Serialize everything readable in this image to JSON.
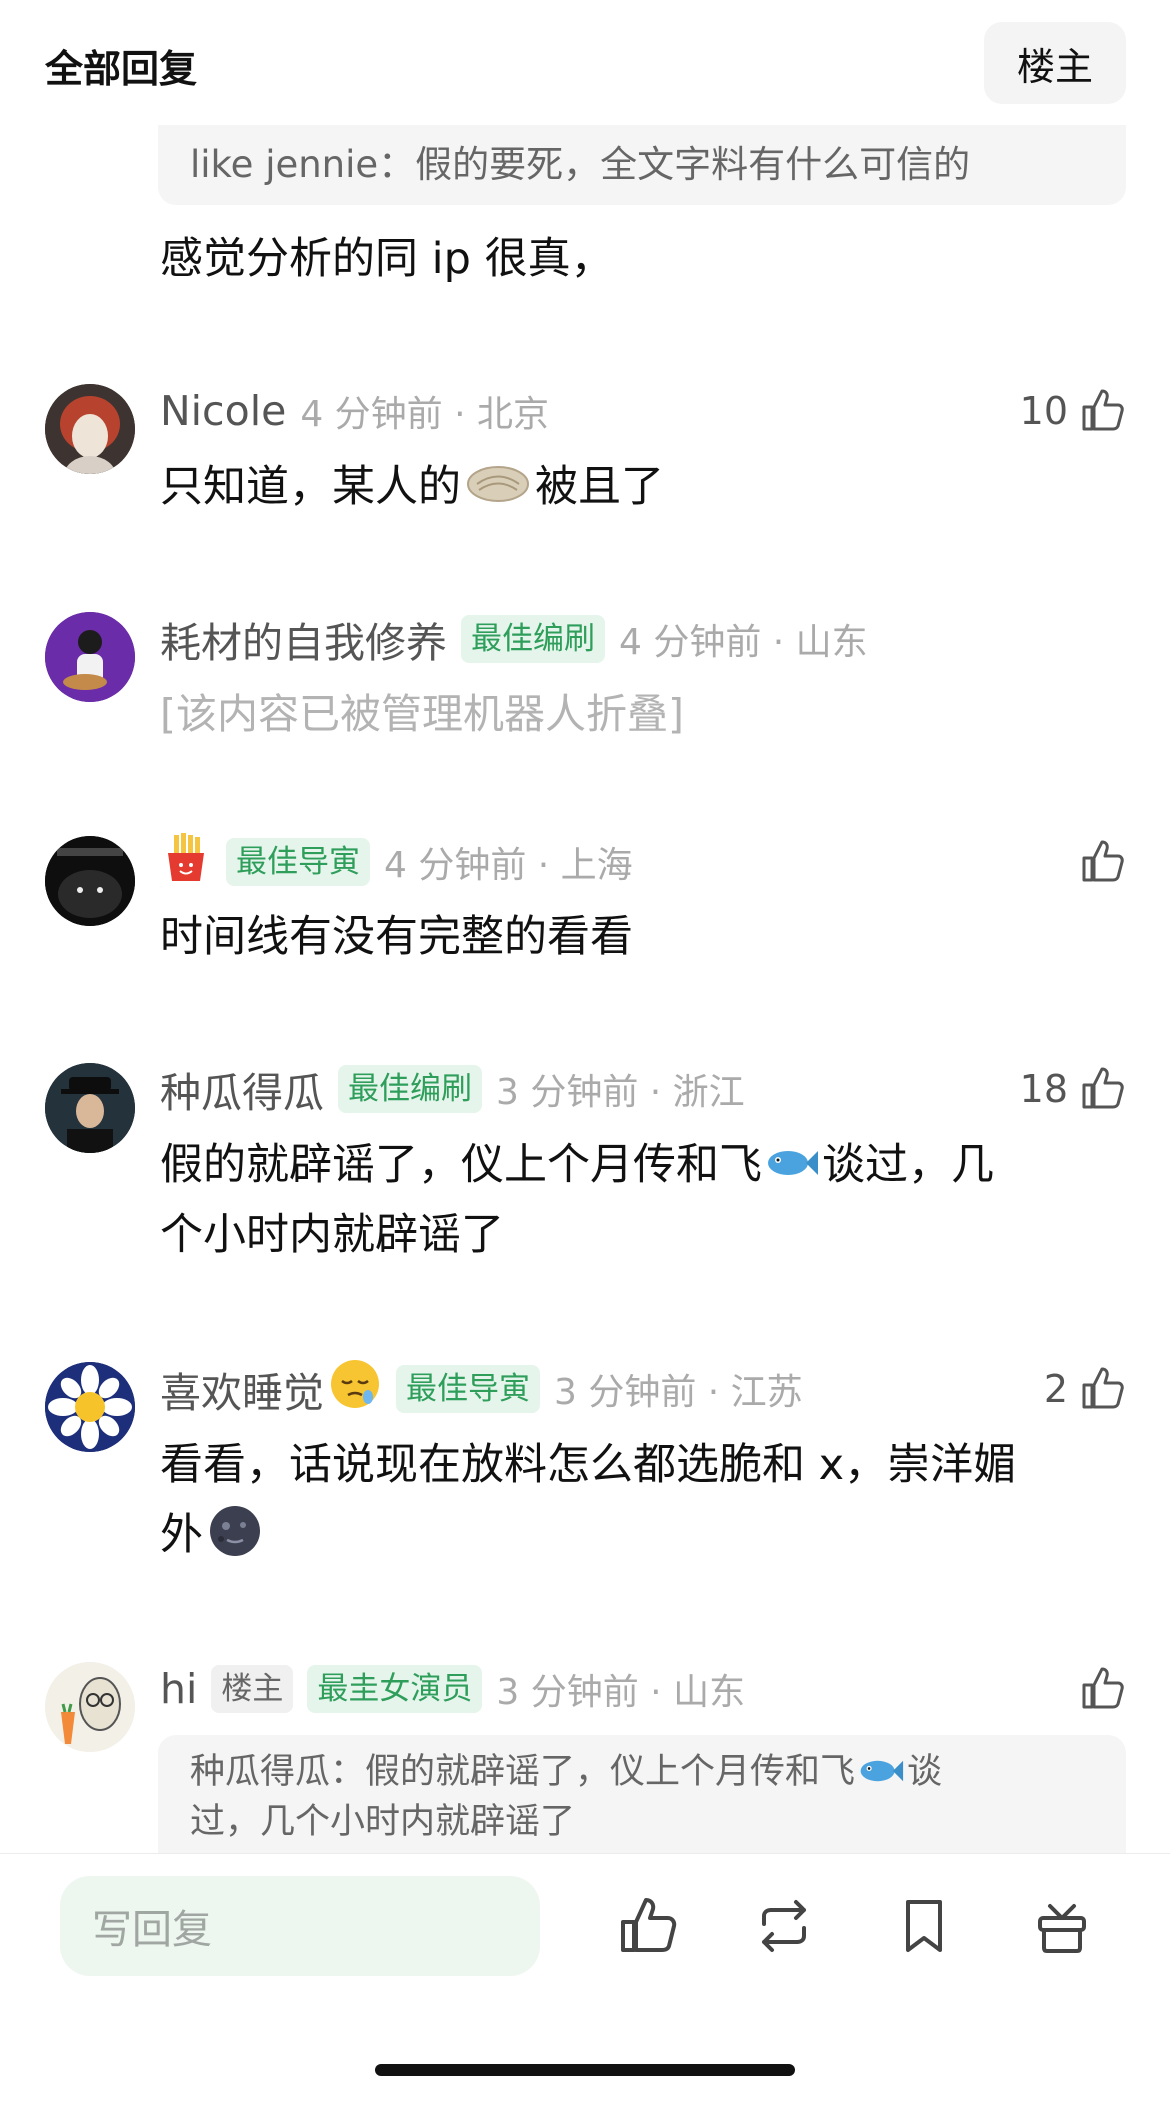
{
  "header": {
    "title": "全部回复",
    "op_button": "楼主"
  },
  "top_quote": {
    "text": "like jennie：假的要死，全文字料有什么可信的"
  },
  "top_comment_text": "感觉分析的同 ip 很真，",
  "comments": [
    {
      "username": "Nicole",
      "badge": "",
      "time_location": "4 分钟前 · 北京",
      "likes": "10",
      "text_before_emoji": "只知道，某人的",
      "emoji": "bread",
      "text_after_emoji": "被且了"
    },
    {
      "username": "耗材的自我修养",
      "badge": "最佳编刷",
      "time_location": "4 分钟前 · 山东",
      "likes": "",
      "folded_text": "[该内容已被管理机器人折叠]"
    },
    {
      "username": "",
      "name_emoji": "fries",
      "badge": "最佳导寅",
      "time_location": "4 分钟前 · 上海",
      "likes": "",
      "text": "时间线有没有完整的看看"
    },
    {
      "username": "种瓜得瓜",
      "badge": "最佳编刷",
      "time_location": "3 分钟前 · 浙江",
      "likes": "18",
      "line1_before": "假的就辟谣了，仪上个月传和飞",
      "emoji": "fish",
      "line1_after": "谈过，几",
      "line2": "个小时内就辟谣了"
    },
    {
      "username": "喜欢睡觉",
      "name_emoji": "sleepy-face",
      "badge": "最佳导寅",
      "time_location": "3 分钟前 · 江苏",
      "likes": "2",
      "line1": "看看，话说现在放料怎么都选脆和 x，崇洋媚",
      "line2_text": "外",
      "line2_emoji": "new-moon-face"
    },
    {
      "username": "hi",
      "op_badge": "楼主",
      "badge": "最圭女演员",
      "time_location": "3 分钟前 · 山东",
      "likes": "",
      "quote_line1_before": "种瓜得瓜：假的就辟谣了，仪上个月传和飞",
      "quote_emoji": "fish",
      "quote_line1_after": "谈",
      "quote_line2": "过，几个小时内就辟谣了"
    }
  ],
  "bottom_bar": {
    "reply_placeholder": "写回复"
  },
  "colors": {
    "accent_green": "#2f9e5b",
    "badge_bg": "#e6f5ec",
    "muted_gray": "#aaaaaa"
  }
}
